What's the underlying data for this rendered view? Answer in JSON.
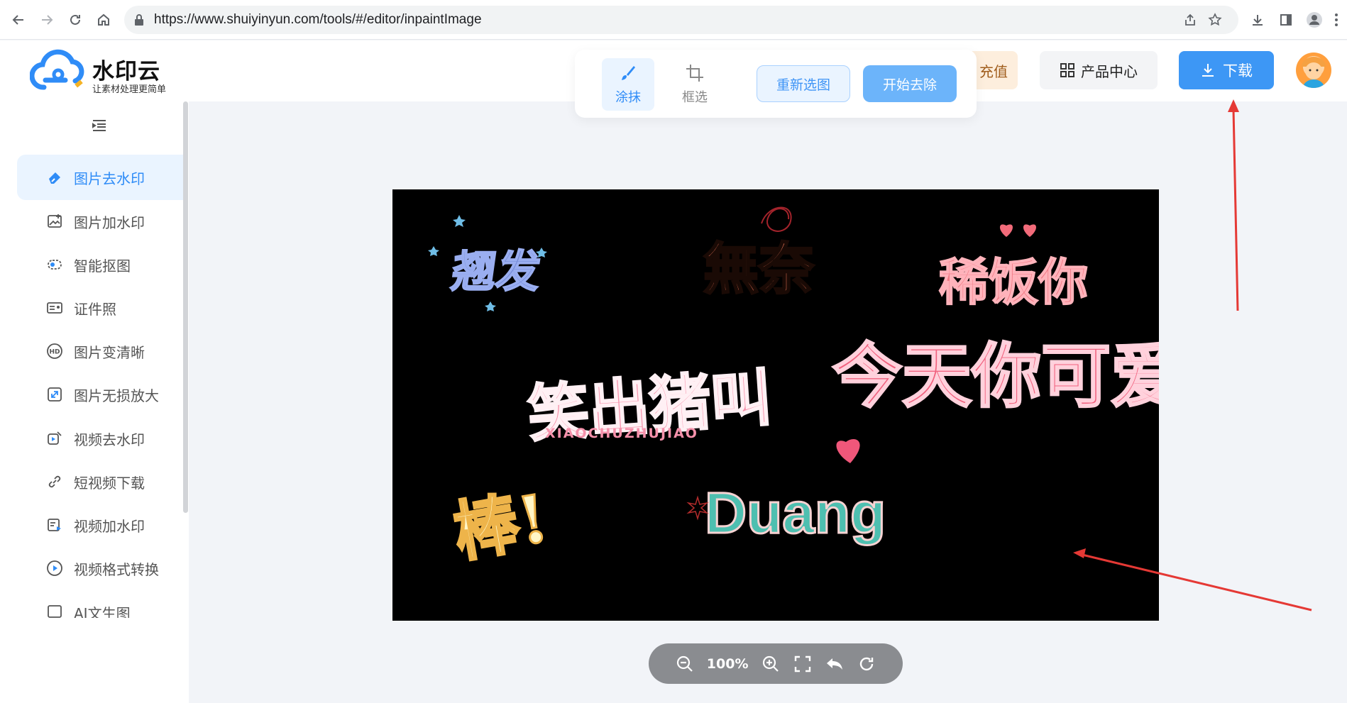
{
  "browser": {
    "url": "https://www.shuiyinyun.com/tools/#/editor/inpaintImage"
  },
  "header": {
    "logo_title": "水印云",
    "logo_subtitle": "让素材处理更简单",
    "recharge_label": "充值",
    "product_center_label": "产品中心",
    "download_label": "下载"
  },
  "toolbar": {
    "brush_label": "涂抹",
    "select_label": "框选",
    "reselect_label": "重新选图",
    "start_label": "开始去除"
  },
  "sidebar": {
    "items": [
      {
        "label": "图片去水印",
        "icon": "eraser-icon",
        "active": true
      },
      {
        "label": "图片加水印",
        "icon": "image-add-icon",
        "active": false
      },
      {
        "label": "智能抠图",
        "icon": "cutout-icon",
        "active": false
      },
      {
        "label": "证件照",
        "icon": "id-card-icon",
        "active": false
      },
      {
        "label": "图片变清晰",
        "icon": "hd-icon",
        "active": false
      },
      {
        "label": "图片无损放大",
        "icon": "enlarge-icon",
        "active": false
      },
      {
        "label": "视频去水印",
        "icon": "video-eraser-icon",
        "active": false
      },
      {
        "label": "短视频下载",
        "icon": "link-icon",
        "active": false
      },
      {
        "label": "视频加水印",
        "icon": "video-add-icon",
        "active": false
      },
      {
        "label": "视频格式转换",
        "icon": "play-circle-icon",
        "active": false
      },
      {
        "label": "AI文生图",
        "icon": "ai-image-icon",
        "active": false
      }
    ]
  },
  "canvas": {
    "art_texts": [
      "翘发",
      "無奈",
      "稀饭你",
      "笑出猪叫",
      "XIAOCHUZHUJIAO",
      "今天你可爱",
      "棒!",
      "Duang"
    ]
  },
  "zoom": {
    "level": "100%"
  },
  "colors": {
    "accent": "#3d97f5",
    "annotation_arrow": "#e53935"
  }
}
